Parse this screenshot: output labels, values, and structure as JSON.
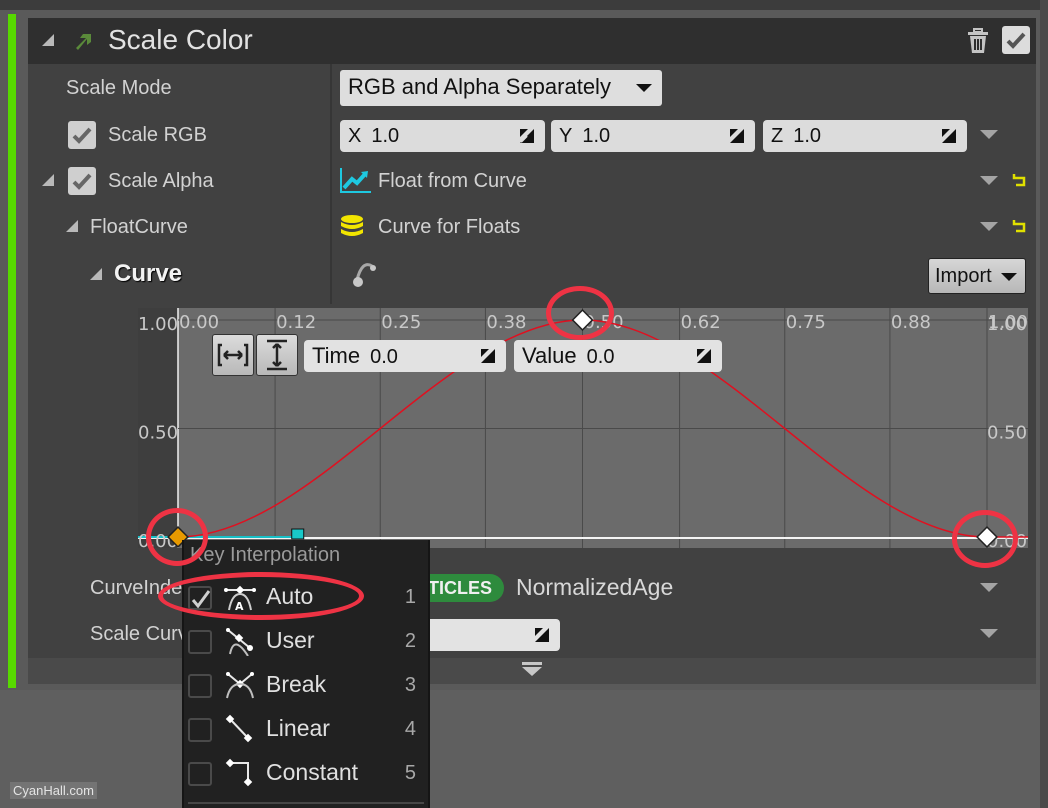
{
  "module": {
    "title": "Scale Color",
    "enabled": true,
    "accent_color": "#57d900"
  },
  "properties": {
    "scale_mode": {
      "label": "Scale Mode",
      "value": "RGB and Alpha Separately"
    },
    "scale_rgb": {
      "label": "Scale RGB",
      "checked": true,
      "x_label": "X",
      "x": "1.0",
      "y_label": "Y",
      "y": "1.0",
      "z_label": "Z",
      "z": "1.0"
    },
    "scale_alpha": {
      "label": "Scale Alpha",
      "checked": true,
      "value": "Float from Curve"
    },
    "float_curve": {
      "label": "FloatCurve",
      "value": "Curve for Floats"
    },
    "curve": {
      "label": "Curve",
      "import_label": "Import"
    },
    "curve_index": {
      "label": "CurveInde",
      "badge": "TICLES",
      "value": "NormalizedAge"
    },
    "scale_curve": {
      "label": "Scale Curv",
      "value": ""
    }
  },
  "curve_editor": {
    "time_label": "Time",
    "time_value": "0.0",
    "value_label": "Value",
    "value_value": "0.0",
    "fit_horizontal_icon": "fit-horizontal-icon",
    "fit_vertical_icon": "fit-vertical-icon"
  },
  "chart_data": {
    "type": "line",
    "title": "",
    "xlabel": "",
    "ylabel": "",
    "x_ticks": [
      "0.00",
      "0.12",
      "0.25",
      "0.38",
      "0.50",
      "0.62",
      "0.75",
      "0.88",
      "1.00"
    ],
    "y_ticks_left": [
      "1.00",
      "0.50",
      "0.00"
    ],
    "y_ticks_right": [
      "1.00",
      "0.50",
      "0.00"
    ],
    "xlim": [
      0,
      1
    ],
    "ylim": [
      0,
      1
    ],
    "grid": true,
    "series": [
      {
        "name": "Curve",
        "color": "#e01020",
        "keys": [
          {
            "x": 0.0,
            "y": 0.0,
            "selected": true
          },
          {
            "x": 0.5,
            "y": 1.0,
            "selected": false
          },
          {
            "x": 1.0,
            "y": 0.0,
            "selected": false
          }
        ]
      }
    ]
  },
  "context_menu": {
    "title": "Key Interpolation",
    "items": [
      {
        "label": "Auto",
        "shortcut": "1",
        "checked": true,
        "icon": "auto-interp-icon"
      },
      {
        "label": "User",
        "shortcut": "2",
        "checked": false,
        "icon": "user-interp-icon"
      },
      {
        "label": "Break",
        "shortcut": "3",
        "checked": false,
        "icon": "break-interp-icon"
      },
      {
        "label": "Linear",
        "shortcut": "4",
        "checked": false,
        "icon": "linear-interp-icon"
      },
      {
        "label": "Constant",
        "shortcut": "5",
        "checked": false,
        "icon": "constant-interp-icon"
      }
    ]
  },
  "watermark": "CyanHall.com"
}
